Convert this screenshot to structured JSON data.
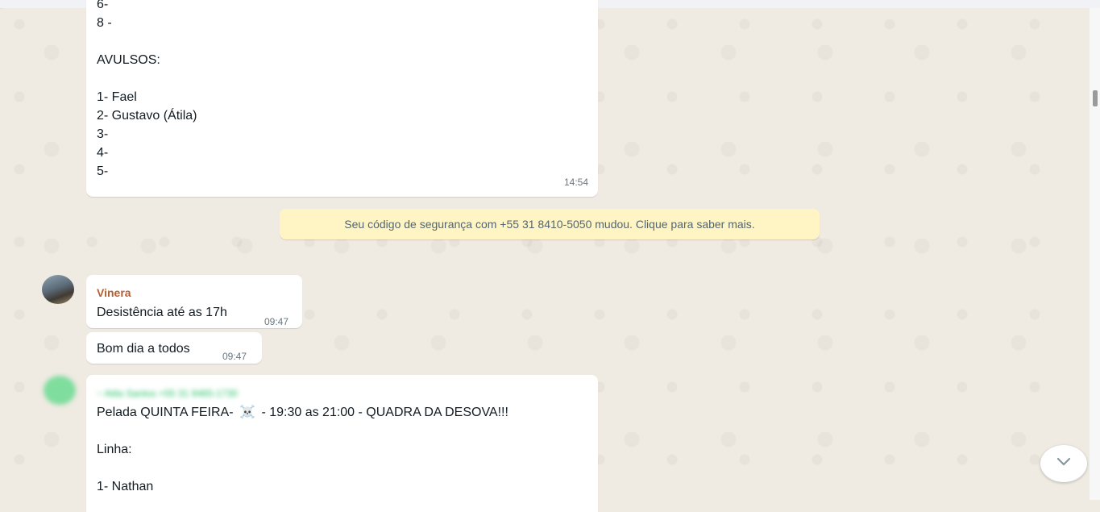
{
  "messages": {
    "first": {
      "lines": [
        "6-",
        "8 -",
        "",
        "AVULSOS:",
        "",
        "1- Fael",
        "2- Gustavo (Átila)",
        "3-",
        "4-",
        "5-"
      ],
      "time": "14:54"
    },
    "system": {
      "text": "Seu código de segurança com +55 31 8410-5050 mudou. Clique para saber mais."
    },
    "vinera_1": {
      "sender": "Vinera",
      "text": "Desistência até as 17h",
      "time": "09:47"
    },
    "vinera_2": {
      "text": "Bom dia a todos",
      "time": "09:47"
    },
    "last": {
      "sender_obscured": "~ Atila Santos +55 31 9465-1730",
      "line1_before": "Pelada QUINTA FEIRA-",
      "line1_emoji": "☠️",
      "line1_after": "- 19:30 as 21:00 - QUADRA DA DESOVA!!!",
      "lines": [
        "",
        "Linha:",
        "",
        "1- Nathan"
      ]
    }
  },
  "icons": {
    "scroll_down": "chevron-down-icon",
    "skull": "skull-crossbones-icon"
  }
}
